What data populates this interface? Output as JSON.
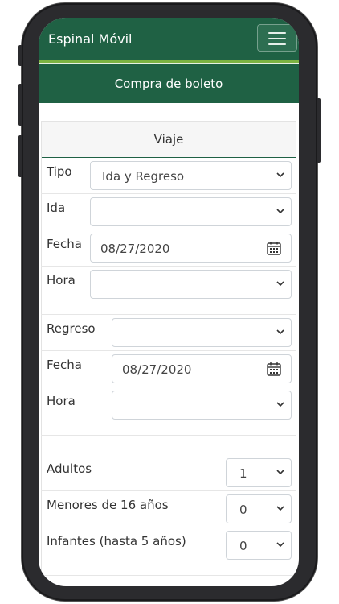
{
  "app": {
    "title": "Espinal Móvil"
  },
  "banner": {
    "title": "Compra de boleto"
  },
  "section": {
    "title": "Viaje"
  },
  "form": {
    "tipo": {
      "label": "Tipo",
      "value": "Ida y Regreso"
    },
    "ida": {
      "label": "Ida",
      "value": ""
    },
    "ida_fecha": {
      "label": "Fecha",
      "value": "08/27/2020"
    },
    "ida_hora": {
      "label": "Hora",
      "value": ""
    },
    "regreso": {
      "label": "Regreso",
      "value": ""
    },
    "regreso_fecha": {
      "label": "Fecha",
      "value": "08/27/2020"
    },
    "regreso_hora": {
      "label": "Hora",
      "value": ""
    },
    "adultos": {
      "label": "Adultos",
      "value": "1"
    },
    "menores": {
      "label": "Menores de 16 años",
      "value": "0"
    },
    "infantes": {
      "label": "Infantes (hasta 5 años)",
      "value": "0"
    }
  },
  "icons": {
    "menu": "hamburger-icon",
    "dropdown": "chevron-down-icon",
    "calendar": "calendar-icon"
  },
  "colors": {
    "primary": "#1f6144",
    "accent": "#7cb342"
  }
}
